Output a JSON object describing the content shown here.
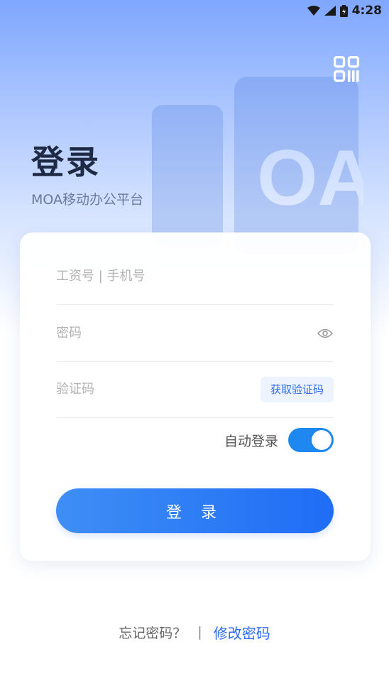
{
  "status_bar": {
    "time": "4:28"
  },
  "header": {
    "title": "登录",
    "subtitle": "MOA移动办公平台",
    "watermark_text": "OA"
  },
  "form": {
    "account_placeholder": "工资号 | 手机号",
    "password_placeholder": "密码",
    "code_placeholder": "验证码",
    "get_code_label": "获取验证码",
    "auto_login_label": "自动登录",
    "auto_login_enabled": true,
    "login_button_label": "登 录"
  },
  "footer": {
    "forgot_label": "忘记密码？",
    "separator": "|",
    "modify_label": "修改密码"
  },
  "colors": {
    "accent": "#2f6bf0",
    "toggle_on": "#1e88f0",
    "title": "#1f2a44"
  },
  "icons": {
    "wifi": "wifi-icon",
    "signal": "signal-icon",
    "battery": "battery-icon",
    "qr": "qr-code-icon",
    "eye": "eye-icon"
  }
}
